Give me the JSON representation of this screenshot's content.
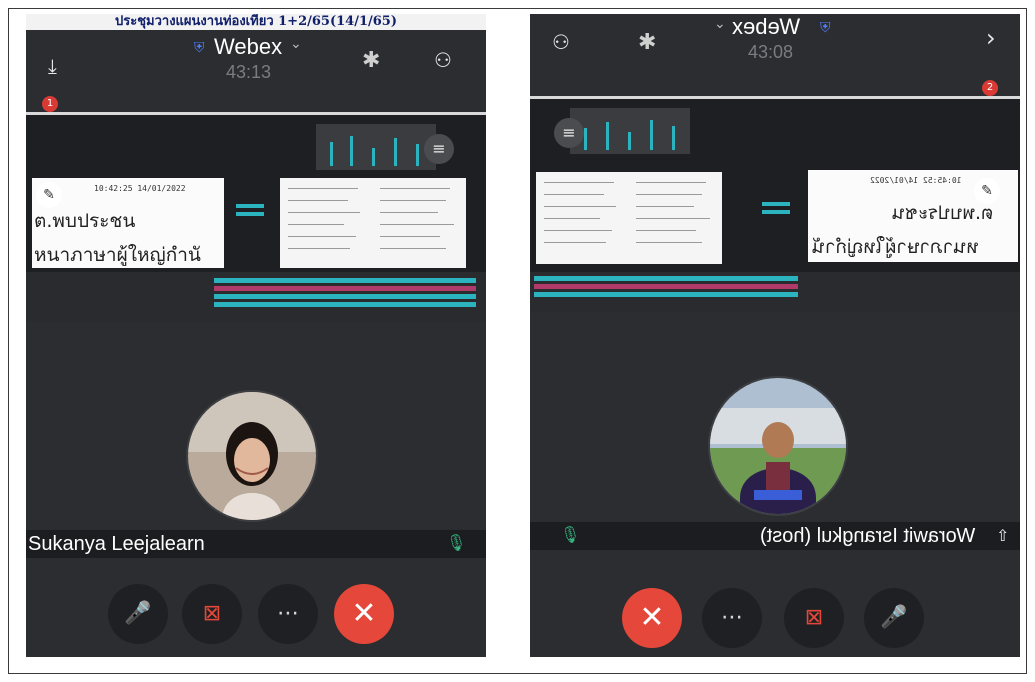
{
  "left_panel": {
    "banner_title": "ประชุมวางแผนงานท่องเที่ยว 1+2/65(14/1/65)",
    "app_title": "Webex",
    "timer": "43:13",
    "badge_count": "1",
    "slide_timestamp": "10:42:25 14/01/2022",
    "slide_line_1": "ต.พบประชน",
    "slide_line_2": "หนาภาษาผู้ใหญ่กำนั",
    "participant_name": "Sukanya Leejalearn",
    "controls": [
      "mute-audio",
      "stop-video",
      "more",
      "leave"
    ]
  },
  "right_panel": {
    "app_title": "Webex",
    "timer": "43:08",
    "badge_count": "2",
    "slide_timestamp": "10:45:52 14/01/2022",
    "slide_line_1": "ต.พบประชน",
    "slide_line_2": "หนาภาษาผู้ใหญ่กำนั",
    "participant_name": "Worawit Israngkul (host)",
    "controls": [
      "leave",
      "more",
      "stop-video",
      "mute-audio"
    ]
  },
  "colors": {
    "background": "#2b2d31",
    "accent_red": "#e5483a",
    "mic_green": "#36b37e",
    "share_cyan": "#2bb3c0",
    "shield_blue": "#4f7fff"
  },
  "icons": {
    "more": "⋯",
    "leave": "✕",
    "chevron": "⌄"
  }
}
